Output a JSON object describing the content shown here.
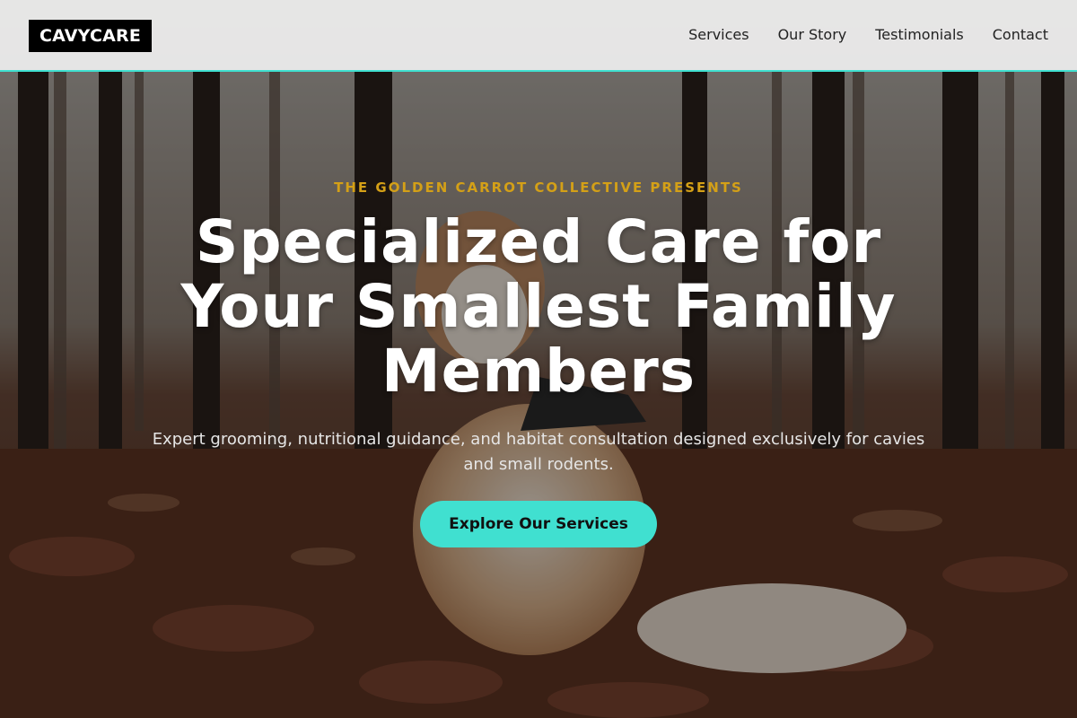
{
  "header": {
    "logo_text": "CAVYCARE",
    "nav": [
      {
        "label": "Services"
      },
      {
        "label": "Our Story"
      },
      {
        "label": "Testimonials"
      },
      {
        "label": "Contact"
      }
    ]
  },
  "hero": {
    "eyebrow": "THE GOLDEN CARROT COLLECTIVE PRESENTS",
    "headline": "Specialized Care for Your Smallest Family Members",
    "subtext": "Expert grooming, nutritional guidance, and habitat consultation designed exclusively for cavies and small rodents.",
    "cta_label": "Explore Our Services",
    "background_image": "dog-in-autumn-forest"
  },
  "colors": {
    "accent": "#40e0d0",
    "eyebrow": "#d4a017",
    "header_bg": "#f0f0f0",
    "logo_bg": "#000000"
  }
}
